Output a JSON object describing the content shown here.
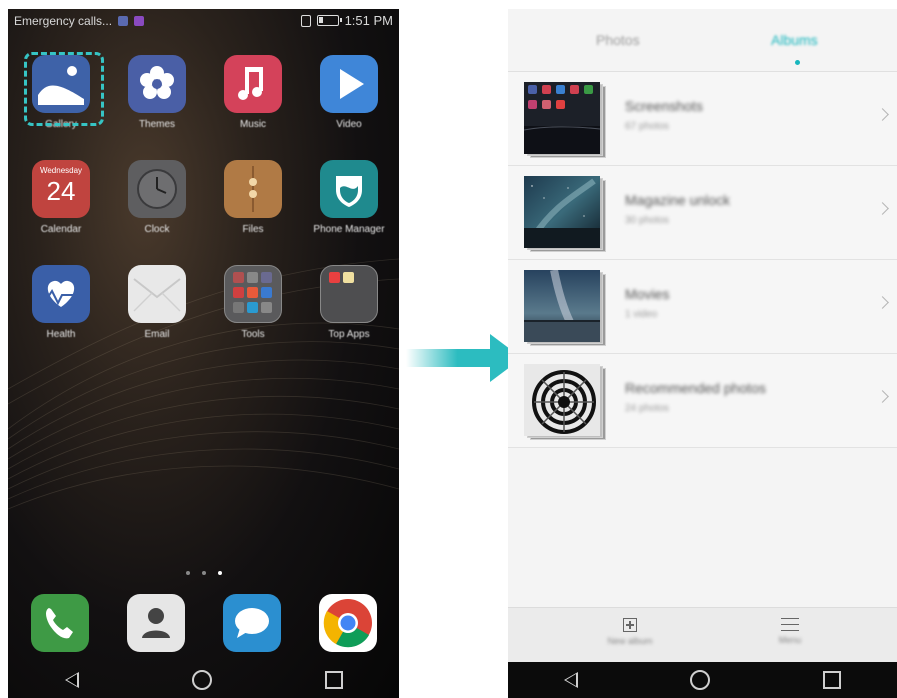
{
  "left_phone": {
    "status_bar": {
      "carrier": "Emergency calls...",
      "time": "1:51 PM",
      "notification_colors": [
        "#5a6ab0",
        "#8a4ac0"
      ]
    },
    "apps": [
      {
        "label": "Gallery",
        "icon": "gallery-icon",
        "color": "#3e62a8"
      },
      {
        "label": "Themes",
        "icon": "themes-icon",
        "color": "#4a5fa6"
      },
      {
        "label": "Music",
        "icon": "music-icon",
        "color": "#d4425a"
      },
      {
        "label": "Video",
        "icon": "video-icon",
        "color": "#3f86d8"
      },
      {
        "label": "Calendar",
        "icon": "calendar-icon",
        "color": "#c0443f",
        "day_name": "Wednesday",
        "day_number": "24"
      },
      {
        "label": "Clock",
        "icon": "clock-icon",
        "color": "#5e5e60"
      },
      {
        "label": "Files",
        "icon": "files-icon",
        "color": "#b07a45"
      },
      {
        "label": "Phone Manager",
        "icon": "phone-manager-icon",
        "color": "#1f8a8e"
      },
      {
        "label": "Health",
        "icon": "health-icon",
        "color": "#3a5fa8"
      },
      {
        "label": "Email",
        "icon": "email-icon",
        "color": "#e8e8e8"
      },
      {
        "label": "Tools",
        "icon": "tools-folder-icon",
        "color": "#5a5a5c"
      },
      {
        "label": "Top Apps",
        "icon": "top-apps-folder-icon",
        "color": "#4e4e50"
      }
    ],
    "dock": [
      {
        "icon": "phone-icon",
        "color": "#3e9a45"
      },
      {
        "icon": "contacts-icon",
        "color": "#e6e6e6"
      },
      {
        "icon": "messaging-icon",
        "color": "#2b8fd0"
      },
      {
        "icon": "chrome-icon",
        "color": "#ffffff"
      }
    ]
  },
  "arrow": {
    "color": "#2cbcc0"
  },
  "right_phone": {
    "tabs": [
      {
        "label": "Photos",
        "active": false
      },
      {
        "label": "Albums",
        "active": true
      }
    ],
    "albums": [
      {
        "title": "Screenshots",
        "count": "67 photos"
      },
      {
        "title": "Magazine unlock",
        "count": "30 photos"
      },
      {
        "title": "Movies",
        "count": "1 video"
      },
      {
        "title": "Recommended photos",
        "count": "24 photos"
      }
    ],
    "bottom_actions": [
      {
        "label": "New album",
        "icon": "add-album-icon"
      },
      {
        "label": "Menu",
        "icon": "menu-icon"
      }
    ],
    "accent": "#17b6bd"
  }
}
